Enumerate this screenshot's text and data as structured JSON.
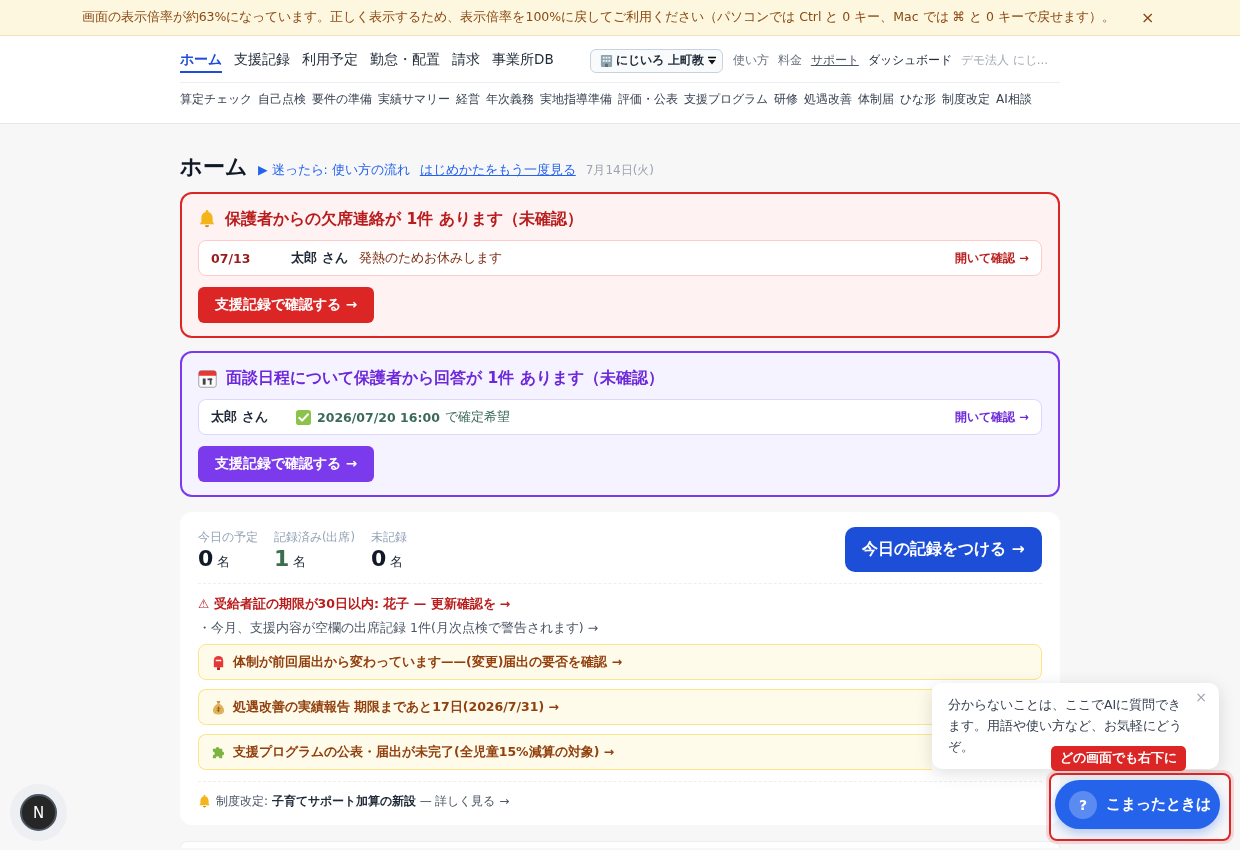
{
  "zoom_banner": {
    "message": "画面の表示倍率が約63%になっています。正しく表示するため、表示倍率を100%に戻してご利用ください（パソコンでは Ctrl と 0 キー、Mac では ⌘ と 0 キーで戻せます）。",
    "close": "×"
  },
  "header": {
    "nav_tabs": [
      {
        "label": "ホーム",
        "selected": true
      },
      {
        "label": "支援記録",
        "selected": false
      },
      {
        "label": "利用予定",
        "selected": false
      },
      {
        "label": "勤怠・配置",
        "selected": false
      },
      {
        "label": "請求",
        "selected": false
      },
      {
        "label": "事業所DB",
        "selected": false
      }
    ],
    "facility_select": {
      "value": "にじいろ 上町教"
    },
    "links": [
      {
        "label": "使い方",
        "kind": "muted"
      },
      {
        "label": "料金",
        "kind": "muted"
      },
      {
        "label": "サポート",
        "kind": "underlined"
      },
      {
        "label": "ダッシュボード",
        "kind": "strong"
      },
      {
        "label": "デモ法人 にじ...",
        "kind": "faint"
      }
    ],
    "sub_nav": [
      "算定チェック",
      "自己点検",
      "要件の準備",
      "実績サマリー",
      "経営",
      "年次義務",
      "実地指導準備",
      "評価・公表",
      "支援プログラム",
      "研修",
      "処遇改善",
      "体制届",
      "ひな形",
      "制度改定",
      "AI相談"
    ]
  },
  "page": {
    "title": "ホーム",
    "guide_link": "▶ 迷ったら: 使い方の流れ",
    "restart_link": "はじめかたをもう一度見る",
    "date": "7月14日(火)"
  },
  "alerts": [
    {
      "kind": "absence",
      "title": "保護者からの欠席連絡が 1件 あります（未確認）",
      "rows": [
        {
          "date": "07/13",
          "name": "太郎 さん",
          "message": "発熱のためお休みします",
          "action": "開いて確認 →"
        }
      ],
      "button": "支援記録で確認する →"
    },
    {
      "kind": "interview",
      "title": "面談日程について保護者から回答が 1件 あります（未確認）",
      "rows": [
        {
          "name": "太郎 さん",
          "datetime": "2026/07/20 16:00",
          "message": "で確定希望",
          "action": "開いて確認 →"
        }
      ],
      "button": "支援記録で確認する →"
    }
  ],
  "today": {
    "stats": [
      {
        "label": "今日の予定",
        "value": "0",
        "unit": "名",
        "kind": "plain"
      },
      {
        "label": "記録済み(出席)",
        "value": "1",
        "unit": "名",
        "kind": "done"
      },
      {
        "label": "未記録",
        "value": "0",
        "unit": "名",
        "kind": "plain"
      }
    ],
    "record_button": "今日の記録をつける →",
    "warning": "⚠ 受給者証の期限が30日以内: 花子 — 更新確認を →",
    "note": "・今月、支援内容が空欄の出席記録 1件(月次点検で警告されます) →",
    "notices": [
      {
        "kind": "filing",
        "text": "体制が前回届出から変わっています——(変更)届出の要否を確認 →"
      },
      {
        "kind": "report",
        "text": "処遇改善の実績報告 期限まであと17日(2026/7/31) →"
      },
      {
        "kind": "program",
        "text": "支援プログラムの公表・届出が未完了(全児童15%減算の対象) →"
      }
    ],
    "revision": "制度改定: **子育てサポート加算の新設** — 詳しく見る →"
  },
  "help": {
    "bubble": "分からないことは、ここでAIに質問できます。用語や使い方など、お気軽にどうぞ。",
    "close": "×",
    "tag": "どの画面でも右下に",
    "mark": "?",
    "button": "こまったときは",
    "highlighted": true
  },
  "dev_indicator": {
    "label": "N"
  }
}
